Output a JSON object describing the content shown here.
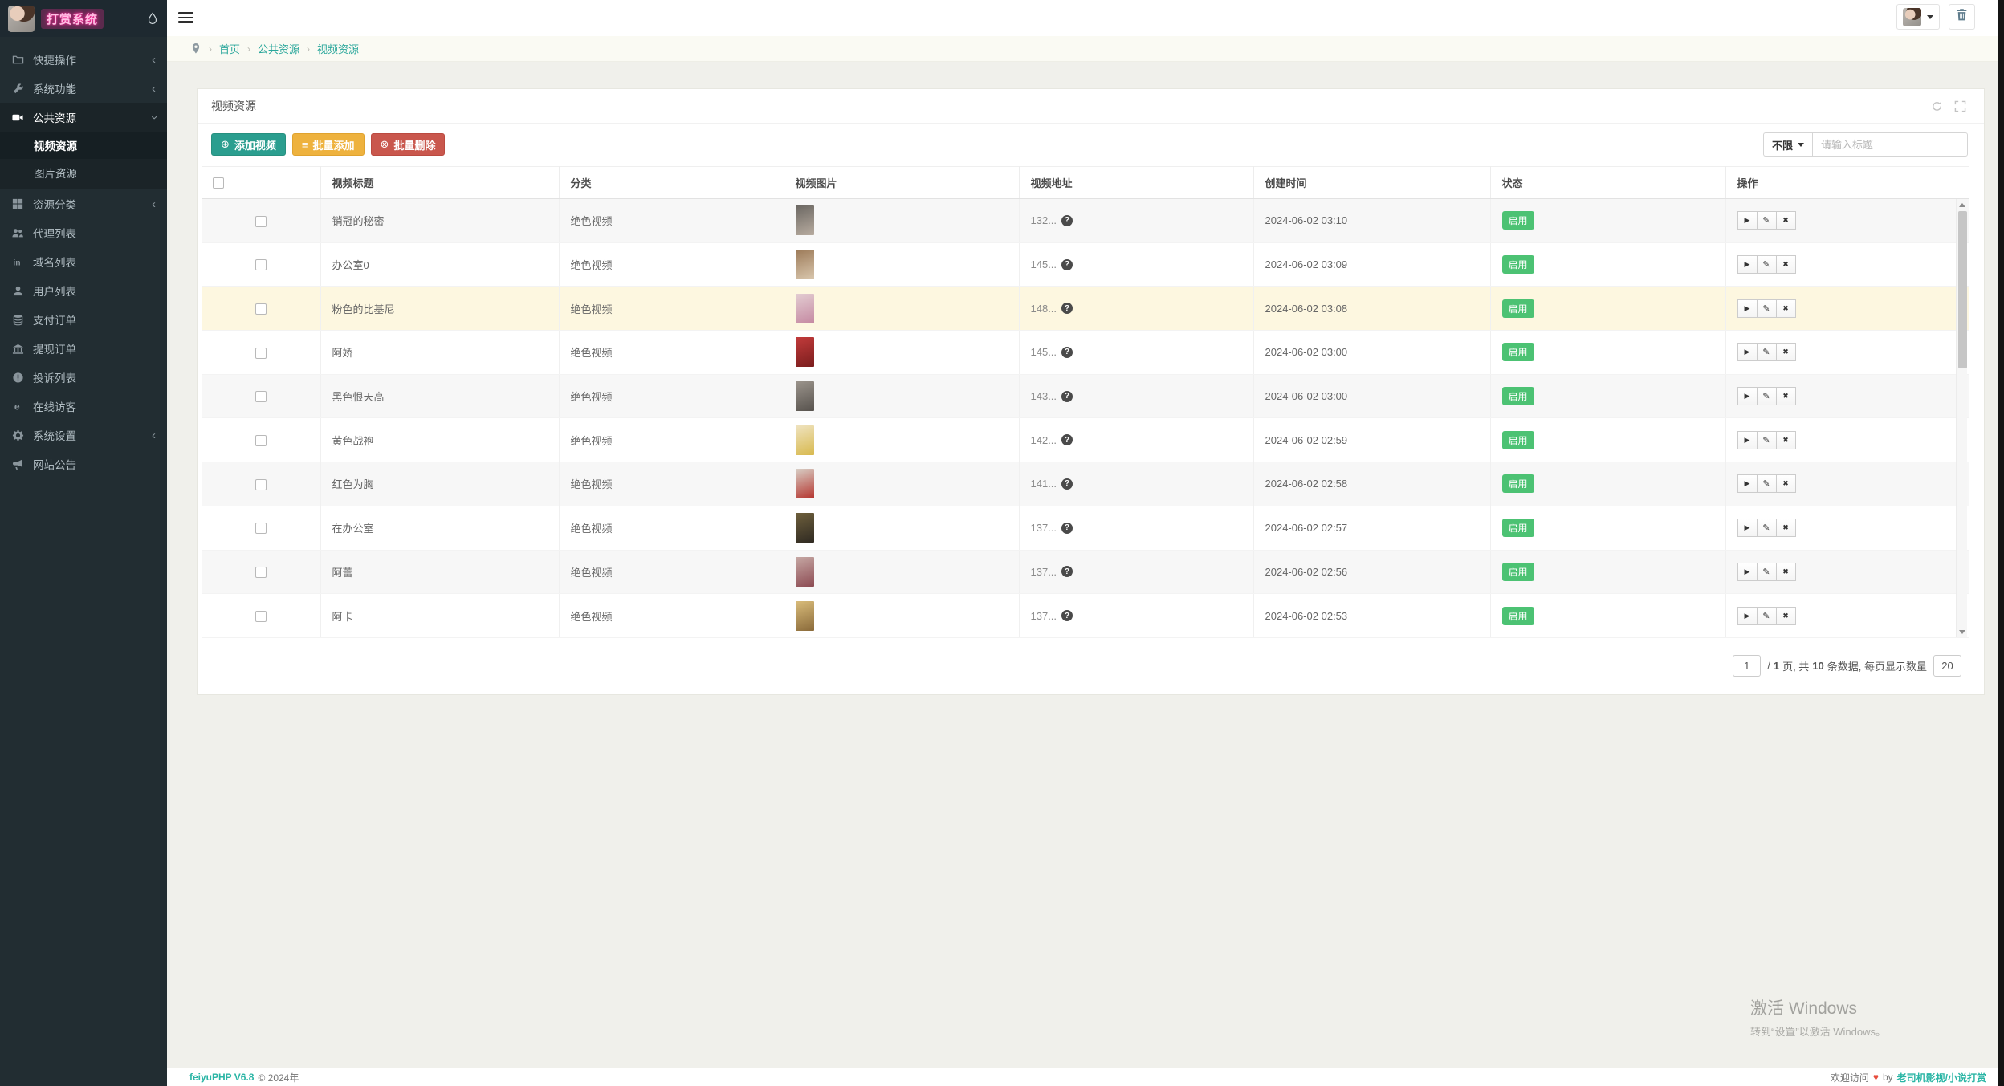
{
  "brand": {
    "title": "打赏系统"
  },
  "sidebar": {
    "items": [
      {
        "label": "快捷操作",
        "icon": "folder-icon",
        "chevron": true
      },
      {
        "label": "系统功能",
        "icon": "wrench-icon",
        "chevron": true
      },
      {
        "label": "公共资源",
        "icon": "video-camera-icon",
        "expanded": true,
        "children": [
          {
            "label": "视频资源",
            "active": true
          },
          {
            "label": "图片资源",
            "active": false
          }
        ]
      },
      {
        "label": "资源分类",
        "icon": "grid-icon",
        "chevron": true
      },
      {
        "label": "代理列表",
        "icon": "users-icon"
      },
      {
        "label": "域名列表",
        "icon": "domain-icon"
      },
      {
        "label": "用户列表",
        "icon": "user-icon"
      },
      {
        "label": "支付订单",
        "icon": "database-icon"
      },
      {
        "label": "提现订单",
        "icon": "bank-icon"
      },
      {
        "label": "投诉列表",
        "icon": "exclamation-icon"
      },
      {
        "label": "在线访客",
        "icon": "visitor-icon"
      },
      {
        "label": "系统设置",
        "icon": "gear-icon",
        "chevron": true
      },
      {
        "label": "网站公告",
        "icon": "bullhorn-icon"
      }
    ]
  },
  "breadcrumb": {
    "items": [
      "首页",
      "公共资源",
      "视频资源"
    ]
  },
  "panel": {
    "title": "视频资源"
  },
  "toolbar": {
    "add_label": "添加视频",
    "batch_add_label": "批量添加",
    "batch_delete_label": "批量删除",
    "filter_label": "不限",
    "search_placeholder": "请输入标题"
  },
  "table": {
    "headers": [
      "视频标题",
      "分类",
      "视频图片",
      "视频地址",
      "创建时间",
      "状态",
      "操作"
    ],
    "rows": [
      {
        "title": "销冠的秘密",
        "category": "绝色视频",
        "address": "132...",
        "time": "2024-06-02 03:10",
        "status": "启用",
        "highlighted": false,
        "thumb": [
          "#6b6762",
          "#b8aca0"
        ]
      },
      {
        "title": "办公室0",
        "category": "绝色视频",
        "address": "145...",
        "time": "2024-06-02 03:09",
        "status": "启用",
        "highlighted": false,
        "thumb": [
          "#9c7a58",
          "#d9c7ae"
        ]
      },
      {
        "title": "粉色的比基尼",
        "category": "绝色视频",
        "address": "148...",
        "time": "2024-06-02 03:08",
        "status": "启用",
        "highlighted": true,
        "thumb": [
          "#e3cdd2",
          "#c589a2"
        ]
      },
      {
        "title": "阿娇",
        "category": "绝色视频",
        "address": "145...",
        "time": "2024-06-02 03:00",
        "status": "启用",
        "highlighted": false,
        "thumb": [
          "#c23b3b",
          "#7a1d1d"
        ]
      },
      {
        "title": "黑色恨天高",
        "category": "绝色视频",
        "address": "143...",
        "time": "2024-06-02 03:00",
        "status": "启用",
        "highlighted": false,
        "thumb": [
          "#9b948c",
          "#57524d"
        ]
      },
      {
        "title": "黄色战袍",
        "category": "绝色视频",
        "address": "142...",
        "time": "2024-06-02 02:59",
        "status": "启用",
        "highlighted": false,
        "thumb": [
          "#efe3c0",
          "#d8b94e"
        ]
      },
      {
        "title": "红色为胸",
        "category": "绝色视频",
        "address": "141...",
        "time": "2024-06-02 02:58",
        "status": "启用",
        "highlighted": false,
        "thumb": [
          "#d8cfc6",
          "#b5352f"
        ]
      },
      {
        "title": "在办公室",
        "category": "绝色视频",
        "address": "137...",
        "time": "2024-06-02 02:57",
        "status": "启用",
        "highlighted": false,
        "thumb": [
          "#6e5f3c",
          "#2f2a22"
        ]
      },
      {
        "title": "阿蕾",
        "category": "绝色视频",
        "address": "137...",
        "time": "2024-06-02 02:56",
        "status": "启用",
        "highlighted": false,
        "thumb": [
          "#c6a8a4",
          "#8c4a52"
        ]
      },
      {
        "title": "阿卡",
        "category": "绝色视频",
        "address": "137...",
        "time": "2024-06-02 02:53",
        "status": "启用",
        "highlighted": false,
        "thumb": [
          "#d9bc7a",
          "#8a6a3a"
        ]
      }
    ]
  },
  "pagination": {
    "current_page": "1",
    "seg1": "/",
    "total_pages": "1",
    "seg2": "页, 共",
    "total_items": "10",
    "seg3": "条数据, 每页显示数量",
    "page_size": "20"
  },
  "watermark": {
    "line1": "激活 Windows",
    "line2": "转到“设置”以激活 Windows。"
  },
  "footer": {
    "brand": "feiyuPHP V6.8",
    "copyright": "© 2024年",
    "welcome": "欢迎访问",
    "by": "by",
    "link": "老司机影视/小说打赏"
  },
  "colors": {
    "accent_teal": "#2b9e8f",
    "accent_orange": "#eeb23e",
    "accent_red": "#c9574d",
    "badge_green": "#4cc273",
    "link_teal": "#2aa79b",
    "sidebar_bg": "#222d32",
    "brand_pink": "#ff2d9b"
  }
}
